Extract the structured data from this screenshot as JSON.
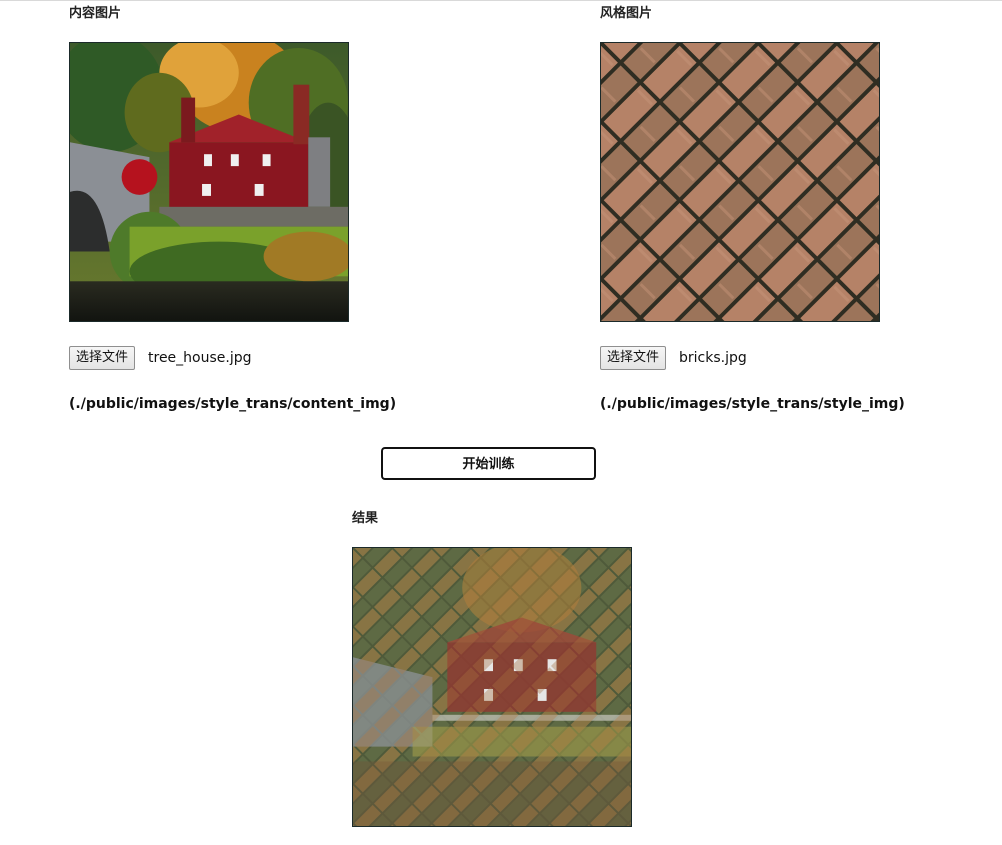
{
  "content": {
    "title": "内容图片",
    "image_alt": "tree_house",
    "choose_label": "选择文件",
    "file_name": "tree_house.jpg",
    "path": "(./public/images/style_trans/content_img)"
  },
  "style": {
    "title": "风格图片",
    "image_alt": "bricks",
    "choose_label": "选择文件",
    "file_name": "bricks.jpg",
    "path": "(./public/images/style_trans/style_img)"
  },
  "train_label": "开始训练",
  "result": {
    "title": "结果",
    "image_alt": "stylized tree_house"
  }
}
